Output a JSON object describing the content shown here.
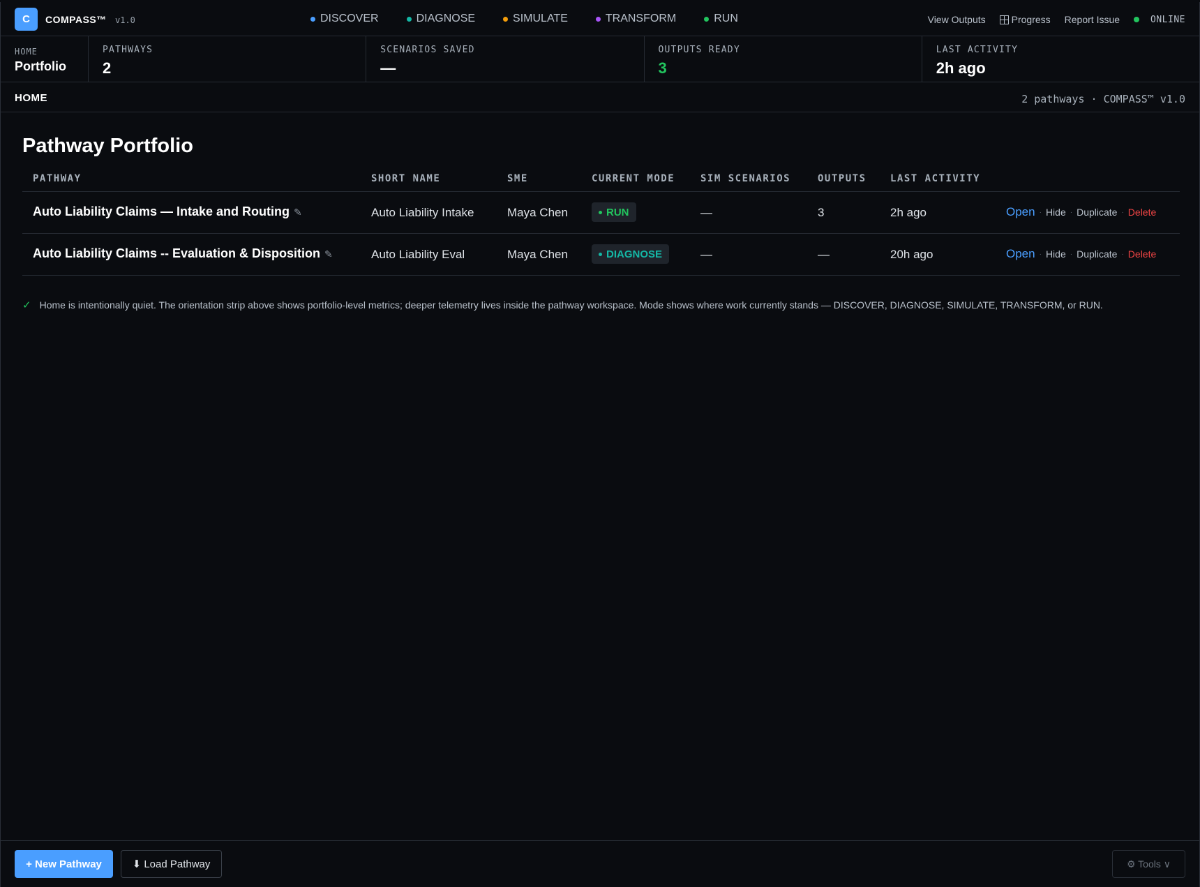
{
  "app": {
    "logo_letter": "C",
    "brand": "COMPASS™",
    "version": "v1.0"
  },
  "modes": [
    {
      "label": "DISCOVER",
      "color": "#4a9eff"
    },
    {
      "label": "DIAGNOSE",
      "color": "#14b8a6"
    },
    {
      "label": "SIMULATE",
      "color": "#f59e0b"
    },
    {
      "label": "TRANSFORM",
      "color": "#a855f7"
    },
    {
      "label": "RUN",
      "color": "#22c55e"
    }
  ],
  "top_right": {
    "view_outputs": "View Outputs",
    "progress": "Progress",
    "report_issue": "Report Issue",
    "status": "ONLINE",
    "status_color": "#22c55e"
  },
  "strip": {
    "home_label": "HOME",
    "home_value": "Portfolio",
    "metrics": [
      {
        "label": "PATHWAYS",
        "value": "2"
      },
      {
        "label": "SCENARIOS SAVED",
        "value": "—"
      },
      {
        "label": "OUTPUTS READY",
        "value": "3"
      },
      {
        "label": "LAST ACTIVITY",
        "value": "2h ago"
      }
    ]
  },
  "breadcrumb": {
    "current": "HOME",
    "meta": "2 pathways · COMPASS™ v1.0"
  },
  "main": {
    "title": "Pathway Portfolio",
    "columns": [
      "PATHWAY",
      "SHORT NAME",
      "SME",
      "CURRENT MODE",
      "SIM SCENARIOS",
      "OUTPUTS",
      "LAST ACTIVITY"
    ],
    "rows": [
      {
        "pathway": "Auto Liability Claims — Intake and Routing",
        "short_name": "Auto Liability Intake",
        "sme": "Maya Chen",
        "mode": "RUN",
        "mode_color": "#22c55e",
        "sim_scenarios": "—",
        "outputs": "3",
        "last_activity": "2h ago"
      },
      {
        "pathway": "Auto Liability Claims -- Evaluation & Disposition",
        "short_name": "Auto Liability Eval",
        "sme": "Maya Chen",
        "mode": "DIAGNOSE",
        "mode_color": "#14b8a6",
        "sim_scenarios": "—",
        "outputs": "—",
        "last_activity": "20h ago"
      }
    ],
    "actions": {
      "open": "Open",
      "hide": "Hide",
      "duplicate": "Duplicate",
      "delete": "Delete"
    },
    "note": "Home is intentionally quiet. The orientation strip above shows portfolio-level metrics; deeper telemetry lives inside the pathway workspace. Mode shows where work currently stands — DISCOVER, DIAGNOSE, SIMULATE, TRANSFORM, or RUN."
  },
  "footer": {
    "new_pathway": "+ New Pathway",
    "load_pathway": "⬇ Load Pathway",
    "tools": "⚙ Tools ∨"
  }
}
